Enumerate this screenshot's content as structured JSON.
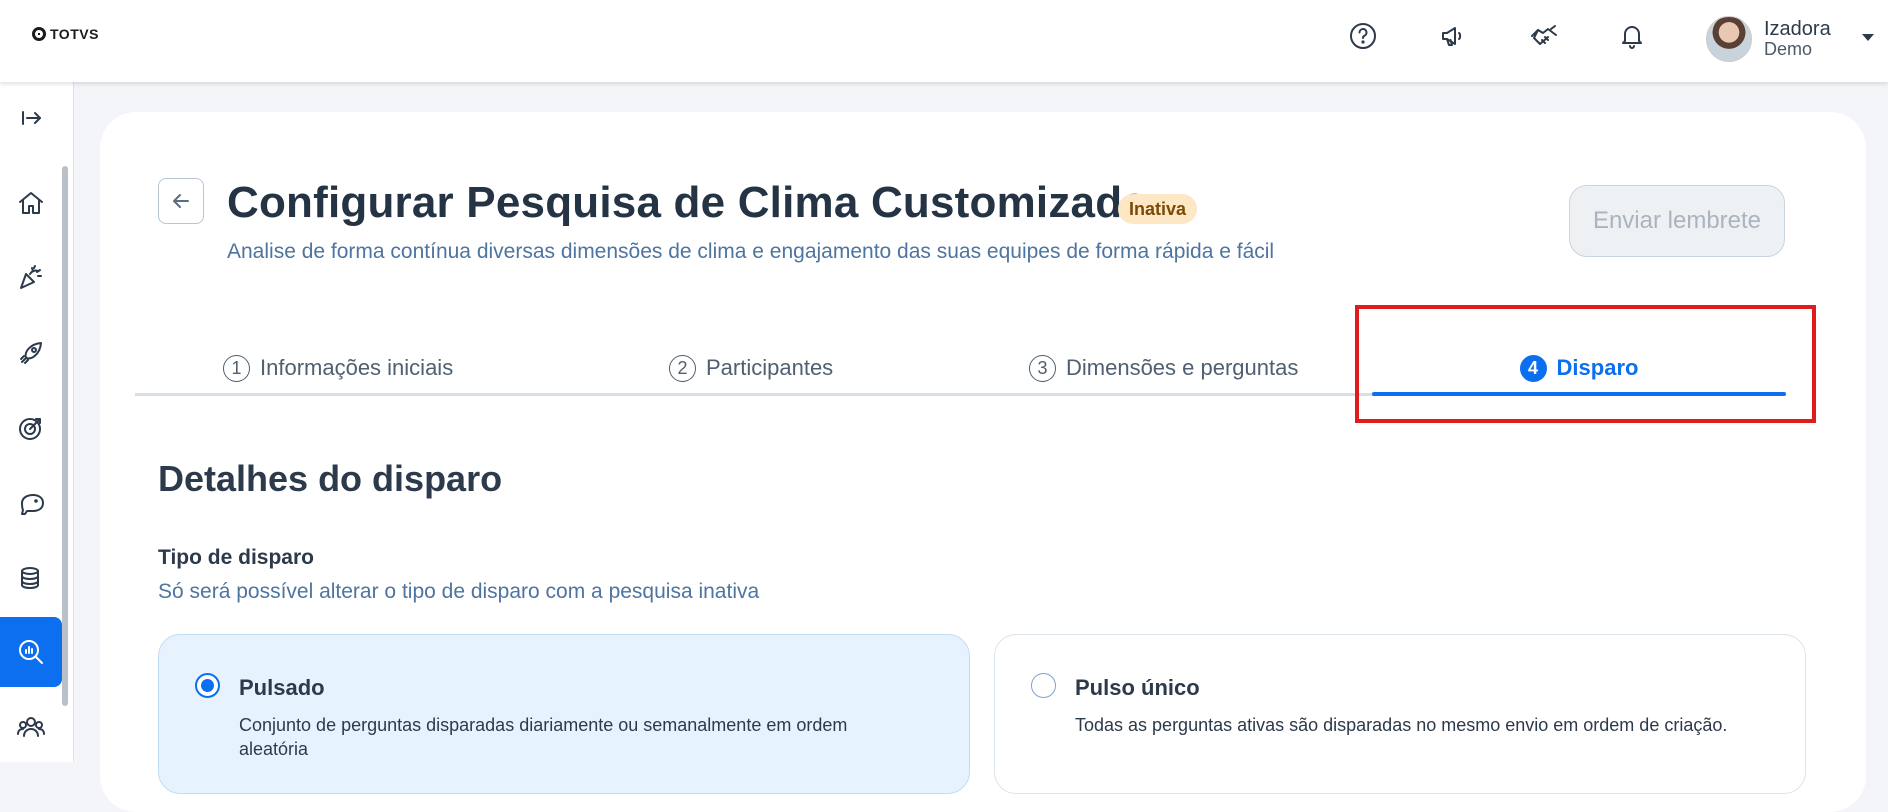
{
  "header": {
    "logo_text": "TOTVS",
    "icons": [
      "help-icon",
      "megaphone-icon",
      "handshake-icon",
      "bell-icon"
    ],
    "user": {
      "name": "Izadora",
      "role": "Demo"
    }
  },
  "sidebar": {
    "items": [
      "expand-icon",
      "home-icon",
      "celebration-icon",
      "rocket-icon",
      "target-icon",
      "piggy-bank-icon",
      "coins-icon",
      "survey-search-icon",
      "people-icon"
    ],
    "active": "survey-search-icon"
  },
  "page": {
    "title": "Configurar Pesquisa de Clima Customizada",
    "status": "Inativa",
    "subtitle": "Analise de forma contínua diversas dimensões de clima e engajamento das suas equipes de forma rápida e fácil",
    "remind_button": "Enviar lembrete"
  },
  "steps": [
    {
      "number": "1",
      "label": "Informações iniciais"
    },
    {
      "number": "2",
      "label": "Participantes"
    },
    {
      "number": "3",
      "label": "Dimensões e perguntas"
    },
    {
      "number": "4",
      "label": "Disparo"
    }
  ],
  "active_step": "4",
  "section": {
    "title": "Detalhes do disparo",
    "field_label": "Tipo de disparo",
    "field_hint": "Só será possível alterar o tipo de disparo com a pesquisa inativa"
  },
  "options": [
    {
      "title": "Pulsado",
      "description": "Conjunto de perguntas disparadas diariamente ou semanalmente em ordem aleatória",
      "selected": true
    },
    {
      "title": "Pulso único",
      "description": "Todas as perguntas ativas são disparadas no mesmo envio em ordem de criação.",
      "selected": false
    }
  ],
  "colors": {
    "accent": "#0c6ff0",
    "badge_bg": "#fde7c5",
    "highlight": "#e01b1b"
  }
}
